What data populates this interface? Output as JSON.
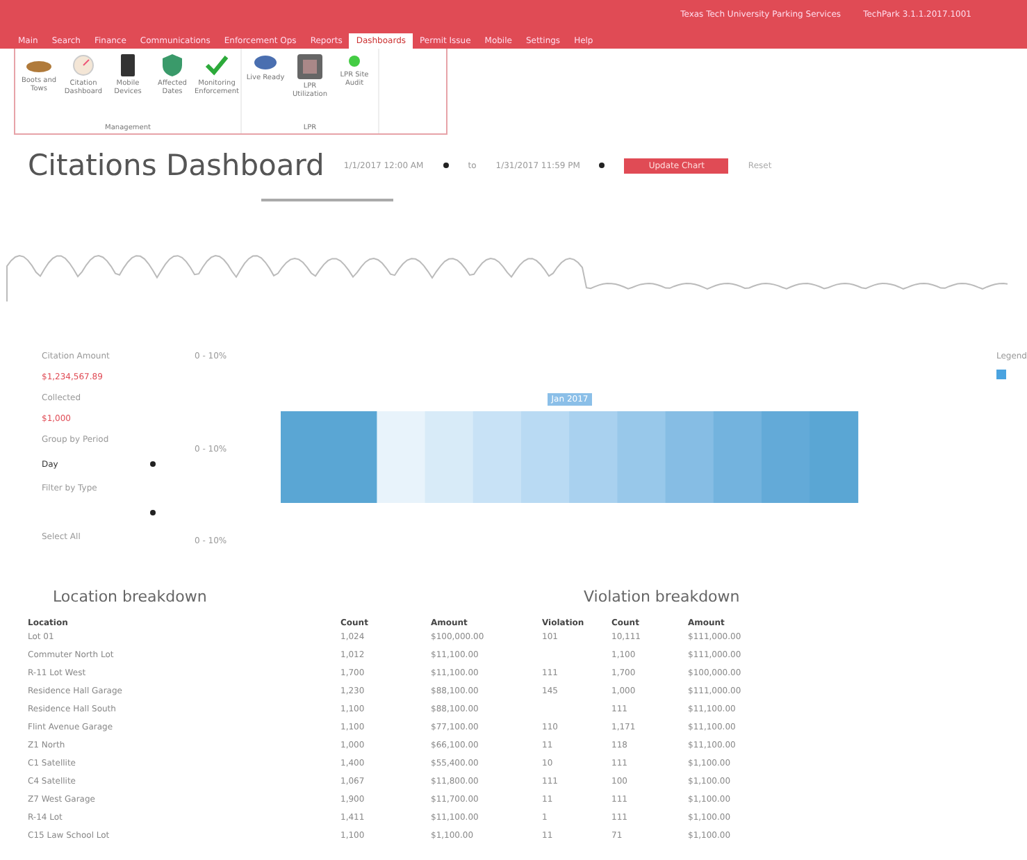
{
  "header": {
    "org": "Texas Tech University Parking Services",
    "build": "TechPark 3.1.1.2017.1001"
  },
  "menu": [
    {
      "label": "Main",
      "selected": false
    },
    {
      "label": "Search",
      "selected": false
    },
    {
      "label": "Finance",
      "selected": false
    },
    {
      "label": "Communications",
      "selected": false
    },
    {
      "label": "Enforcement Ops",
      "selected": false
    },
    {
      "label": "Reports",
      "selected": false
    },
    {
      "label": "Dashboards",
      "selected": true
    },
    {
      "label": "Permit Issue",
      "selected": false
    },
    {
      "label": "Mobile",
      "selected": false
    },
    {
      "label": "Settings",
      "selected": false
    },
    {
      "label": "Help",
      "selected": false
    }
  ],
  "ribbon": {
    "groups": [
      {
        "label": "Management",
        "items": [
          {
            "label": "Boots and Tows"
          },
          {
            "label": "Citation Dashboard"
          },
          {
            "label": "Mobile Devices"
          },
          {
            "label": "Affected Dates"
          },
          {
            "label": "Monitoring Enforcement"
          }
        ]
      },
      {
        "label": "LPR",
        "items": [
          {
            "label": "Live Ready"
          },
          {
            "label": "LPR Utilization"
          },
          {
            "label": "LPR Site Audit"
          }
        ]
      }
    ]
  },
  "title": "Citations Dashboard",
  "filters": {
    "start": "1/1/2017 12:00 AM",
    "separator": "to",
    "end": "1/31/2017 11:59 PM",
    "apply": "Update Chart",
    "reset": "Reset"
  },
  "stats": [
    {
      "label": "Citation Amount",
      "value": "$1,234,567.89"
    },
    {
      "label": "Collected",
      "value": "$1,000"
    }
  ],
  "selects": [
    {
      "label": "Group by Period",
      "value": "Day"
    },
    {
      "label": "Filter by Type"
    }
  ],
  "select_all": "Select All",
  "axis_labels": [
    "0 - 10%",
    "0 - 10%",
    "0 - 10%"
  ],
  "heatmap_label": "Jan 2017",
  "legend": {
    "title": "Legend"
  },
  "location": {
    "title": "Location breakdown",
    "columns": [
      "Location",
      "Count",
      "Amount"
    ],
    "rows": [
      [
        "Lot 01",
        "1,024",
        "$100,000.00"
      ],
      [
        "Commuter North Lot",
        "1,012",
        "$11,100.00"
      ],
      [
        "R-11 Lot West",
        "1,700",
        "$11,100.00"
      ],
      [
        "Residence Hall Garage",
        "1,230",
        "$88,100.00"
      ],
      [
        "Residence Hall South",
        "1,100",
        "$88,100.00"
      ],
      [
        "Flint Avenue Garage",
        "1,100",
        "$77,100.00"
      ],
      [
        "Z1 North",
        "1,000",
        "$66,100.00"
      ],
      [
        "C1 Satellite",
        "1,400",
        "$55,400.00"
      ],
      [
        "C4 Satellite",
        "1,067",
        "$11,800.00"
      ],
      [
        "Z7 West Garage",
        "1,900",
        "$11,700.00"
      ],
      [
        "R-14 Lot",
        "1,411",
        "$11,100.00"
      ],
      [
        "C15 Law School Lot",
        "1,100",
        "$1,100.00"
      ]
    ]
  },
  "violation": {
    "title": "Violation breakdown",
    "columns": [
      "Violation",
      "Count",
      "Amount"
    ],
    "rows": [
      [
        "101",
        "10,111",
        "$111,000.00"
      ],
      [
        "",
        "1,100",
        "$111,000.00"
      ],
      [
        "111",
        "1,700",
        "$100,000.00"
      ],
      [
        "145",
        "1,000",
        "$111,000.00"
      ],
      [
        "",
        "111",
        "$11,100.00"
      ],
      [
        "110",
        "1,171",
        "$11,100.00"
      ],
      [
        "11",
        "118",
        "$11,100.00"
      ],
      [
        "10",
        "111",
        "$1,100.00"
      ],
      [
        "111",
        "100",
        "$1,100.00"
      ],
      [
        "11",
        "111",
        "$1,100.00"
      ],
      [
        "1",
        "111",
        "$1,100.00"
      ],
      [
        "11",
        "71",
        "$1,100.00"
      ]
    ]
  }
}
